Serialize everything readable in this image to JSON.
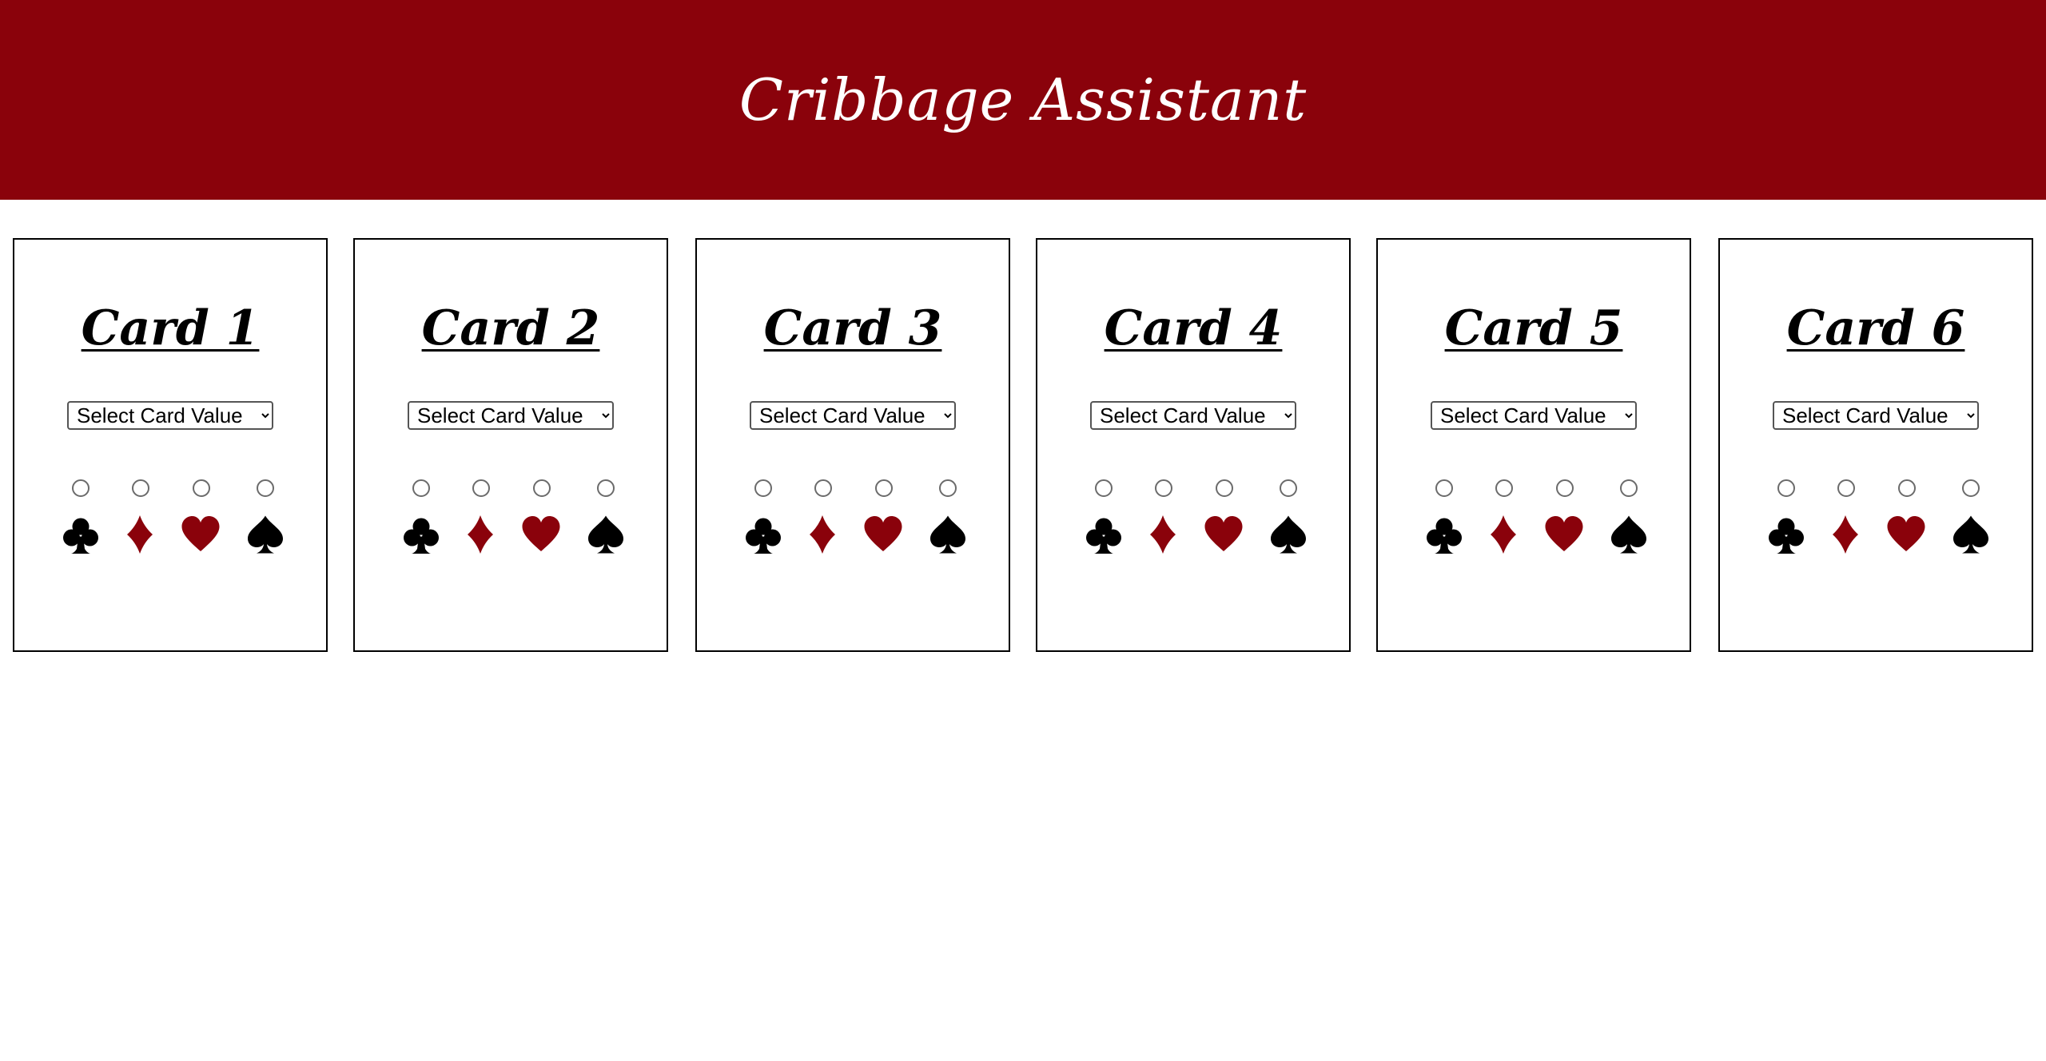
{
  "header": {
    "title": "Cribbage Assistant"
  },
  "cards": [
    {
      "title": "Card 1",
      "select_value": "Select Card Value"
    },
    {
      "title": "Card 2",
      "select_value": "Select Card Value"
    },
    {
      "title": "Card 3",
      "select_value": "Select Card Value"
    },
    {
      "title": "Card 4",
      "select_value": "Select Card Value"
    },
    {
      "title": "Card 5",
      "select_value": "Select Card Value"
    },
    {
      "title": "Card 6",
      "select_value": "Select Card Value"
    }
  ],
  "suits": [
    {
      "icon": "club-icon",
      "color": "#000000"
    },
    {
      "icon": "diamond-icon",
      "color": "#8a020b"
    },
    {
      "icon": "heart-icon",
      "color": "#8a020b"
    },
    {
      "icon": "spade-icon",
      "color": "#000000"
    }
  ],
  "colors": {
    "header_bg": "#8a020b",
    "header_text": "#ffffff",
    "red_suit": "#8a020b",
    "black_suit": "#000000"
  }
}
